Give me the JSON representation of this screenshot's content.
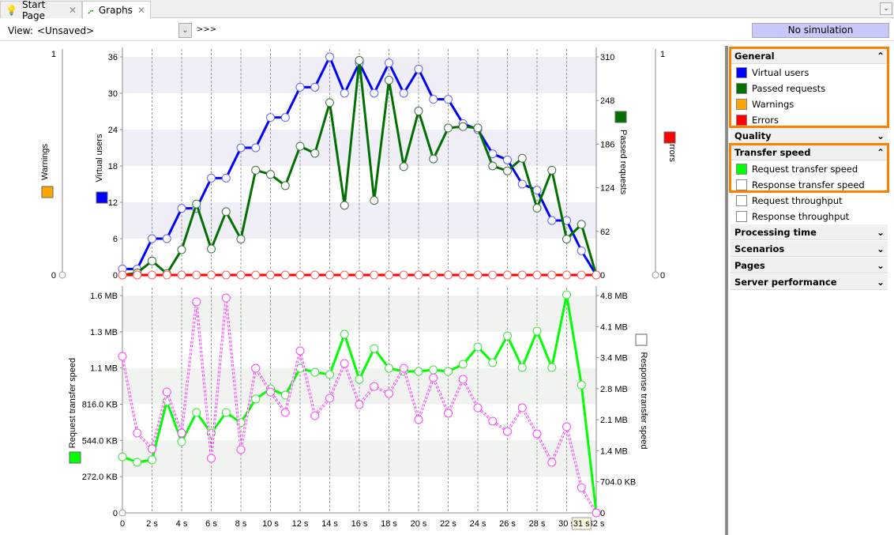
{
  "tabs": [
    {
      "label": "Start Page",
      "icon": "lightbulb-icon"
    },
    {
      "label": "Graphs",
      "icon": "graph-icon"
    }
  ],
  "view": {
    "label": "View:",
    "value": "<Unsaved>",
    "more": ">>>"
  },
  "simulation_status": "No simulation",
  "panel": {
    "sections": [
      {
        "title": "General",
        "expanded": true,
        "highlighted": true,
        "items": [
          {
            "label": "Virtual users",
            "checked": true,
            "color": "#0000ff"
          },
          {
            "label": "Passed requests",
            "checked": true,
            "color": "#007000"
          },
          {
            "label": "Warnings",
            "checked": true,
            "color": "#ffa500"
          },
          {
            "label": "Errors",
            "checked": true,
            "color": "#ff0000"
          }
        ]
      },
      {
        "title": "Quality",
        "expanded": false
      },
      {
        "title": "Transfer speed",
        "expanded": true,
        "highlighted": true,
        "items": [
          {
            "label": "Request transfer speed",
            "checked": true,
            "color": "#00ff00"
          },
          {
            "label": "Response transfer speed",
            "checked": false,
            "color": "#ffffff"
          },
          {
            "label": "Request throughput",
            "checked": false,
            "color": "#ffffff"
          },
          {
            "label": "Response throughput",
            "checked": false,
            "color": "#ffffff"
          }
        ]
      },
      {
        "title": "Processing time",
        "expanded": false
      },
      {
        "title": "Scenarios",
        "expanded": false
      },
      {
        "title": "Pages",
        "expanded": false
      },
      {
        "title": "Server performance",
        "expanded": false
      }
    ]
  },
  "chart_data": [
    {
      "type": "line",
      "x": [
        0,
        1,
        2,
        3,
        4,
        5,
        6,
        7,
        8,
        9,
        10,
        11,
        12,
        13,
        14,
        15,
        16,
        17,
        18,
        19,
        20,
        21,
        22,
        23,
        24,
        25,
        26,
        27,
        28,
        29,
        30,
        31,
        32
      ],
      "xtick_labels": [
        "0",
        "2 s",
        "4 s",
        "6 s",
        "8 s",
        "10 s",
        "12 s",
        "14 s",
        "16 s",
        "18 s",
        "20 s",
        "22 s",
        "24 s",
        "26 s",
        "28 s",
        "30 s",
        "32 s"
      ],
      "hover_label": "31 s",
      "axes": {
        "warnings": {
          "label": "Warnings",
          "ticks": [
            "0",
            "1"
          ],
          "range": [
            0,
            1
          ]
        },
        "virtual_users": {
          "label": "Virtual users",
          "ticks": [
            "0",
            "6",
            "12",
            "18",
            "24",
            "30",
            "36"
          ],
          "range": [
            0,
            36
          ]
        },
        "passed_requests": {
          "label": "Passed requests",
          "ticks": [
            "0",
            "62",
            "124",
            "186",
            "248",
            "310"
          ],
          "range": [
            0,
            310
          ]
        },
        "errors": {
          "label": "Errors",
          "ticks": [
            "0",
            "1"
          ],
          "range": [
            0,
            1
          ]
        }
      },
      "series": [
        {
          "name": "Virtual users",
          "axis": "virtual_users",
          "color": "#0000ff",
          "values": [
            1,
            1,
            6,
            6,
            11,
            11,
            16,
            16,
            21,
            21,
            26,
            26,
            31,
            31,
            36,
            30,
            35,
            30,
            35,
            30,
            34,
            29,
            29,
            25,
            24,
            20,
            19,
            15,
            14,
            9,
            9,
            4,
            0
          ]
        },
        {
          "name": "Passed requests",
          "axis": "passed_requests",
          "color": "#007000",
          "values": [
            0,
            3,
            20,
            2,
            36,
            101,
            37,
            90,
            51,
            149,
            143,
            127,
            183,
            173,
            245,
            99,
            305,
            106,
            277,
            154,
            233,
            165,
            209,
            211,
            209,
            155,
            148,
            166,
            95,
            149,
            51,
            72,
            0
          ]
        },
        {
          "name": "Errors",
          "axis": "errors",
          "color": "#ff0000",
          "values": [
            0,
            0,
            0,
            0,
            0,
            0,
            0,
            0,
            0,
            0,
            0,
            0,
            0,
            0,
            0,
            0,
            0,
            0,
            0,
            0,
            0,
            0,
            0,
            0,
            0,
            0,
            0,
            0,
            0,
            0,
            0,
            0,
            0
          ]
        }
      ]
    },
    {
      "type": "line",
      "x": [
        0,
        1,
        2,
        3,
        4,
        5,
        6,
        7,
        8,
        9,
        10,
        11,
        12,
        13,
        14,
        15,
        16,
        17,
        18,
        19,
        20,
        21,
        22,
        23,
        24,
        25,
        26,
        27,
        28,
        29,
        30,
        31,
        32
      ],
      "xtick_labels": [
        "0",
        "2 s",
        "4 s",
        "6 s",
        "8 s",
        "10 s",
        "12 s",
        "14 s",
        "16 s",
        "18 s",
        "20 s",
        "22 s",
        "24 s",
        "26 s",
        "28 s",
        "30 s",
        "32 s"
      ],
      "axes": {
        "request": {
          "label": "Request transfer speed",
          "unit": "KB",
          "ticks": [
            "0",
            "272.0 KB",
            "544.0 KB",
            "816.0 KB",
            "1.1 MB",
            "1.3 MB",
            "1.6 MB"
          ],
          "range": [
            0,
            1632
          ]
        },
        "response": {
          "label": "Response transfer speed",
          "unit": "KB",
          "ticks": [
            "0",
            "704.0 KB",
            "1.4 MB",
            "2.1 MB",
            "2.8 MB",
            "3.4 MB",
            "4.1 MB",
            "4.8 MB"
          ],
          "range": [
            0,
            4928
          ]
        }
      },
      "series": [
        {
          "name": "Request transfer speed",
          "axis": "request",
          "color": "#00ff00",
          "values": [
            421,
            380,
            398,
            837,
            534,
            754,
            599,
            754,
            677,
            855,
            932,
            884,
            1086,
            1056,
            1039,
            1341,
            1003,
            1234,
            1086,
            1062,
            1062,
            1074,
            1062,
            1116,
            1246,
            1128,
            1329,
            1092,
            1365,
            1092,
            1638,
            961,
            0
          ]
        },
        {
          "name": "Response transfer speed",
          "axis": "response",
          "color": "#ff00ff",
          "values": [
            3548,
            1810,
            1452,
            2742,
            1810,
            4785,
            1236,
            4874,
            1434,
            3279,
            2742,
            2276,
            3674,
            2204,
            2598,
            3387,
            2455,
            2867,
            2706,
            3279,
            2115,
            3064,
            2258,
            3028,
            2383,
            2079,
            1846,
            2383,
            1792,
            1147,
            1953,
            573,
            0
          ]
        }
      ]
    }
  ]
}
